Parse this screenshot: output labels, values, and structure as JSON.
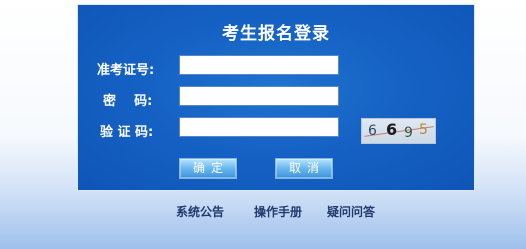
{
  "login": {
    "title": "考生报名登录",
    "fields": {
      "exam_id_label": "准考证号:",
      "password_label": "密    码:",
      "captcha_label": "验 证 码:",
      "exam_id_value": "",
      "password_value": "",
      "captcha_value": ""
    },
    "captcha_image": {
      "chars": [
        "6",
        "6",
        "9",
        "5"
      ]
    },
    "buttons": {
      "confirm": "确定",
      "cancel": "取消"
    }
  },
  "footer_links": {
    "announcement": "系统公告",
    "manual": "操作手册",
    "faq": "疑问问答"
  },
  "colors": {
    "panel": "#1562c4",
    "button": "#68b7ee",
    "link": "#243a6e"
  }
}
